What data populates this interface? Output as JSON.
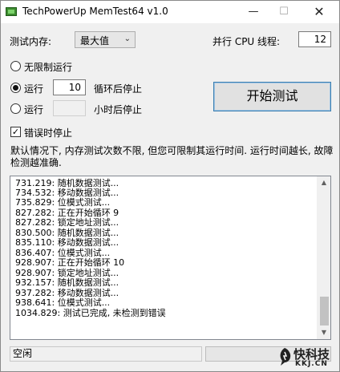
{
  "window": {
    "title": "TechPowerUp MemTest64 v1.0",
    "icons": {
      "app": "memory-chip-icon",
      "minimize": "minimize-icon",
      "maximize": "maximize-icon",
      "close": "close-icon"
    },
    "minimize_glyph": "—",
    "maximize_glyph": "☐",
    "close_glyph": "✕"
  },
  "settings": {
    "memory_label": "测试内存:",
    "memory_value": "最大值",
    "memory_arrow": "⌄",
    "threads_label": "并行 CPU 线程:",
    "threads_value": "12"
  },
  "mode": {
    "unlimited_label": "无限制运行",
    "loops_label": "运行",
    "loops_value": "10",
    "loops_suffix": "循环后停止",
    "hours_label": "运行",
    "hours_value": "",
    "hours_suffix": "小时后停止",
    "selected": "loops"
  },
  "stop_on_error": {
    "label": "错误时停止",
    "checked": true,
    "check_glyph": "✓"
  },
  "start_button": {
    "label": "开始测试"
  },
  "description": "默认情况下, 内存测试次数不限, 但您可限制其运行时间. 运行时间越长, 故障检测越准确.",
  "log": [
    "731.219: 随机数据测试...",
    "734.532: 移动数据测试...",
    "735.829: 位模式测试...",
    "827.282: 正在开始循环 9",
    "827.282: 锁定地址测试...",
    "830.500: 随机数据测试...",
    "835.110: 移动数据测试...",
    "836.407: 位模式测试...",
    "928.907: 正在开始循环 10",
    "928.907: 锁定地址测试...",
    "932.157: 随机数据测试...",
    "937.282: 移动数据测试...",
    "938.641: 位模式测试...",
    "1034.829: 测试已完成, 未检测到错误"
  ],
  "scrollbar": {
    "up_glyph": "▲",
    "down_glyph": "▼"
  },
  "status": {
    "text": "空闲"
  },
  "watermark": {
    "main": "快科技",
    "sub": "KKJ.CN"
  }
}
